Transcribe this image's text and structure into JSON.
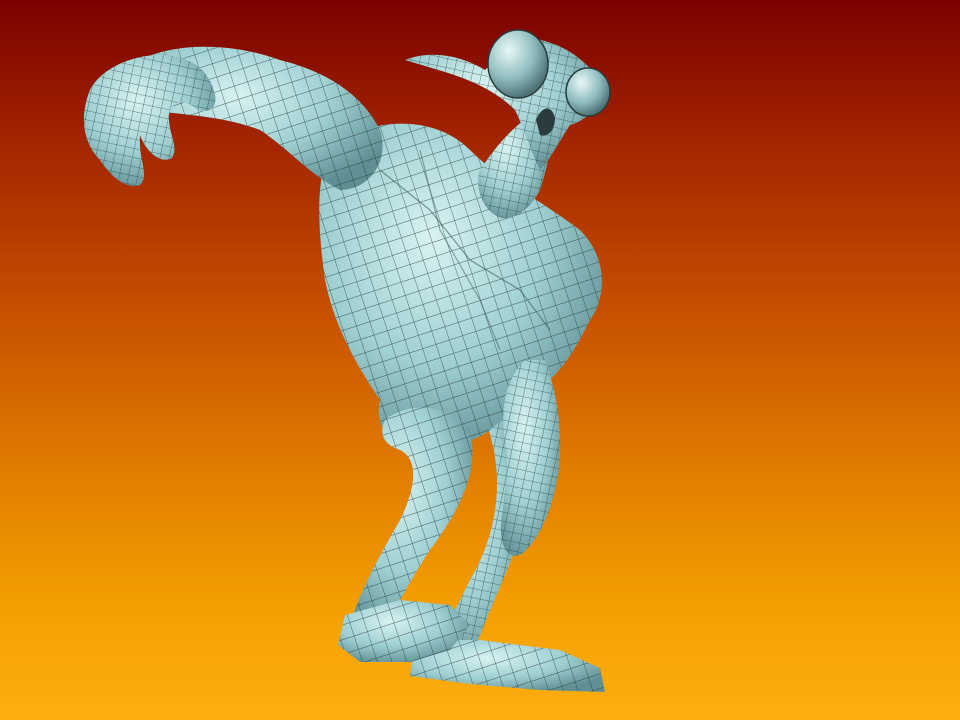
{
  "scene": {
    "background_colors": {
      "top": "#7a0000",
      "middle": "#c24a00",
      "bottom": "#ffae10"
    },
    "model": {
      "material_color": "#9fd0d2",
      "shadow_color": "#5f8f93",
      "highlight_color": "#d8f2f2",
      "wire_color": "#1e2e30"
    }
  }
}
